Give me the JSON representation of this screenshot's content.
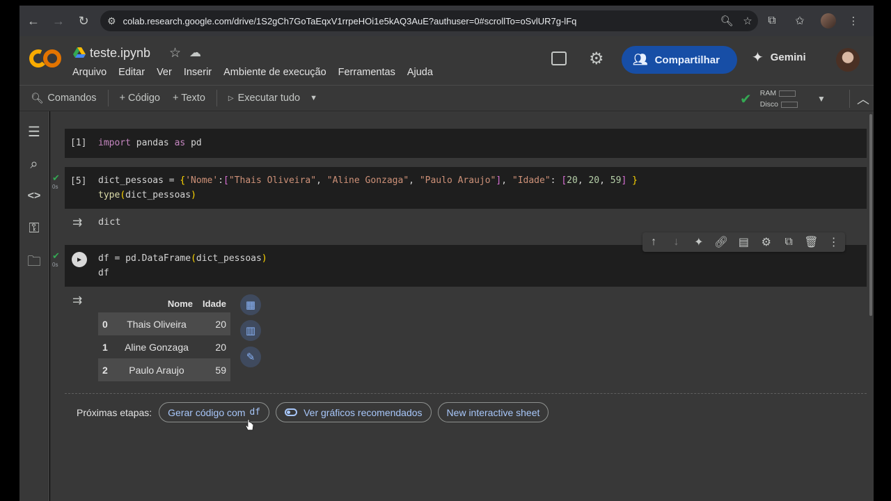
{
  "browser": {
    "url": "colab.research.google.com/drive/1S2gCh7GoTaEqxV1rrpeHOi1e5kAQ3AuE?authuser=0#scrollTo=oSvlUR7g-lFq"
  },
  "header": {
    "logo_text": "CO",
    "file_name": "teste.ipynb",
    "menu": [
      "Arquivo",
      "Editar",
      "Ver",
      "Inserir",
      "Ambiente de execução",
      "Ferramentas",
      "Ajuda"
    ],
    "share_label": "Compartilhar",
    "gemini_label": "Gemini"
  },
  "toolbar": {
    "commands_label": "Comandos",
    "code_label": "+ Código",
    "text_label": "+ Texto",
    "run_all_label": "Executar tudo",
    "ram_label": "RAM",
    "disk_label": "Disco"
  },
  "cells": [
    {
      "exec_count": "[1]",
      "lines": [
        [
          {
            "t": "import",
            "c": "kw"
          },
          {
            "t": " pandas ",
            "c": ""
          },
          {
            "t": "as",
            "c": "kw"
          },
          {
            "t": " pd",
            "c": ""
          }
        ]
      ]
    },
    {
      "exec_count": "[5]",
      "exec_time": "0s",
      "lines": [
        [
          {
            "t": "dict_pessoas = ",
            "c": ""
          },
          {
            "t": "{",
            "c": "br1"
          },
          {
            "t": "'Nome'",
            "c": "str"
          },
          {
            "t": ":",
            "c": ""
          },
          {
            "t": "[",
            "c": "br2"
          },
          {
            "t": "\"Thais Oliveira\"",
            "c": "str"
          },
          {
            "t": ", ",
            "c": ""
          },
          {
            "t": "\"Aline Gonzaga\"",
            "c": "str"
          },
          {
            "t": ", ",
            "c": ""
          },
          {
            "t": "\"Paulo Araujo\"",
            "c": "str"
          },
          {
            "t": "]",
            "c": "br2"
          },
          {
            "t": ", ",
            "c": ""
          },
          {
            "t": "\"Idade\"",
            "c": "str"
          },
          {
            "t": ": ",
            "c": ""
          },
          {
            "t": "[",
            "c": "br2"
          },
          {
            "t": "20",
            "c": "num"
          },
          {
            "t": ", ",
            "c": ""
          },
          {
            "t": "20",
            "c": "num"
          },
          {
            "t": ", ",
            "c": ""
          },
          {
            "t": "59",
            "c": "num"
          },
          {
            "t": "]",
            "c": "br2"
          },
          {
            "t": " ",
            "c": ""
          },
          {
            "t": "}",
            "c": "br1"
          }
        ],
        [
          {
            "t": "type",
            "c": "fn"
          },
          {
            "t": "(",
            "c": "br1"
          },
          {
            "t": "dict_pessoas",
            "c": ""
          },
          {
            "t": ")",
            "c": "br1"
          }
        ]
      ],
      "output": "dict"
    },
    {
      "exec_time": "0s",
      "lines": [
        [
          {
            "t": "df = pd.DataFrame",
            "c": ""
          },
          {
            "t": "(",
            "c": "br1"
          },
          {
            "t": "dict_pessoas",
            "c": ""
          },
          {
            "t": ")",
            "c": "br1"
          }
        ],
        [
          {
            "t": "df",
            "c": ""
          }
        ]
      ]
    }
  ],
  "dataframe": {
    "columns": [
      "Nome",
      "Idade"
    ],
    "rows": [
      {
        "index": "0",
        "nome": "Thais Oliveira",
        "idade": "20"
      },
      {
        "index": "1",
        "nome": "Aline Gonzaga",
        "idade": "20"
      },
      {
        "index": "2",
        "nome": "Paulo Araujo",
        "idade": "59"
      }
    ]
  },
  "next_steps": {
    "label": "Próximas etapas:",
    "generate_code": "Gerar código com",
    "generate_code_var": "df",
    "charts": "Ver gráficos recomendados",
    "sheet": "New interactive sheet"
  },
  "icons": {
    "share": "people-icon",
    "gemini": "sparkle-icon"
  }
}
